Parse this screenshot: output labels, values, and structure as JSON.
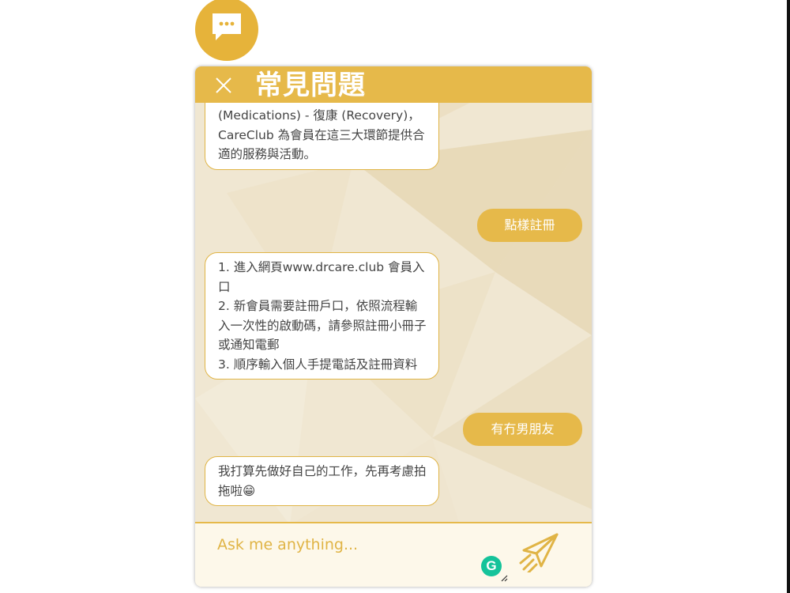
{
  "header": {
    "title": "常見問題",
    "close_icon": "close-icon"
  },
  "launcher": {
    "icon": "chat-bubble-icon"
  },
  "messages": [
    {
      "from": "bot",
      "text": "由健康、治療到康復三大環節組成 - 維持治療 (Maintenance) - 治療自癒 (Medications) - 復康 (Recovery)，CareClub 為會員在這三大環節提供合適的服務與活動。"
    },
    {
      "from": "user",
      "text": "點樣註冊"
    },
    {
      "from": "bot",
      "text": "1. 進入網頁www.drcare.club 會員入口\n2. 新會員需要註冊戶口，依照流程輸入一次性的啟動碼，請參照註冊小冊子或通知電郵\n3. 順序輸入個人手提電話及註冊資料"
    },
    {
      "from": "user",
      "text": "有冇男朋友"
    },
    {
      "from": "bot",
      "text": "我打算先做好自己的工作，先再考慮拍拖啦😁"
    }
  ],
  "composer": {
    "placeholder": "Ask me anything...",
    "send_icon": "paper-plane-icon",
    "extension_label": "G",
    "extension_icon": "grammarly-icon"
  },
  "colors": {
    "accent": "#e6b94a",
    "bubble_border": "#e0b445",
    "text": "#444444",
    "grammarly": "#15c39a"
  }
}
